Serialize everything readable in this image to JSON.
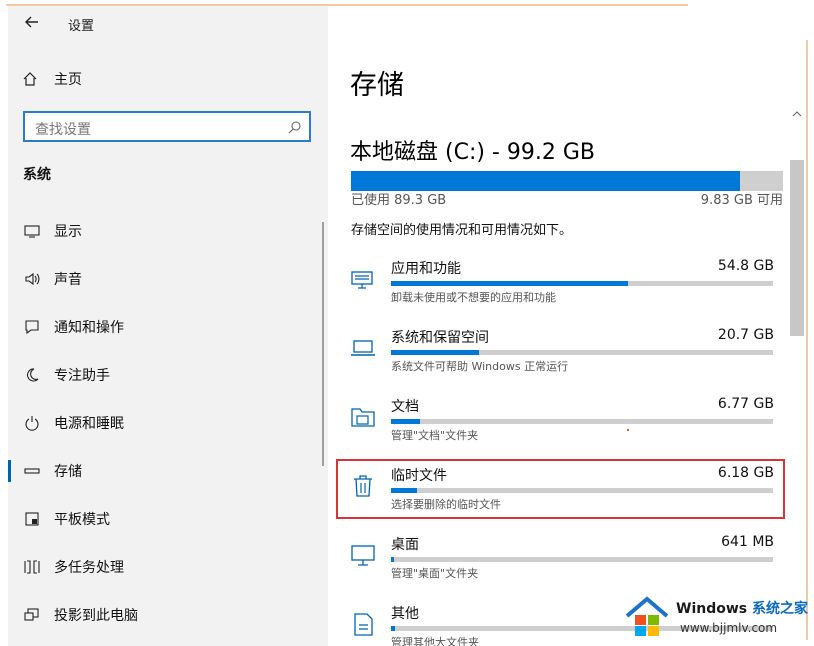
{
  "app": {
    "title": "设置"
  },
  "sidebar": {
    "home_label": "主页",
    "search_placeholder": "查找设置",
    "section": "系统",
    "items": [
      {
        "label": "显示",
        "icon": "monitor-icon"
      },
      {
        "label": "声音",
        "icon": "speaker-icon"
      },
      {
        "label": "通知和操作",
        "icon": "notification-icon"
      },
      {
        "label": "专注助手",
        "icon": "moon-icon"
      },
      {
        "label": "电源和睡眠",
        "icon": "power-icon"
      },
      {
        "label": "存储",
        "icon": "storage-icon",
        "active": true
      },
      {
        "label": "平板模式",
        "icon": "tablet-icon"
      },
      {
        "label": "多任务处理",
        "icon": "multitask-icon"
      },
      {
        "label": "投影到此电脑",
        "icon": "project-icon"
      }
    ]
  },
  "main": {
    "title": "存储",
    "disk": {
      "title": "本地磁盘 (C:) - 99.2 GB",
      "used_label": "已使用 89.3 GB",
      "free_label": "9.83 GB 可用",
      "used_fraction": 0.9
    },
    "description": "存储空间的使用情况和可用情况如下。",
    "categories": [
      {
        "name": "应用和功能",
        "size": "54.8 GB",
        "sub": "卸载未使用或不想要的应用和功能",
        "fraction": 0.62,
        "icon": "apps-icon"
      },
      {
        "name": "系统和保留空间",
        "size": "20.7 GB",
        "sub": "系统文件可帮助 Windows 正常运行",
        "fraction": 0.23,
        "icon": "laptop-icon"
      },
      {
        "name": "文档",
        "size": "6.77 GB",
        "sub": "管理\"文档\"文件夹",
        "fraction": 0.075,
        "icon": "documents-folder-icon"
      },
      {
        "name": "临时文件",
        "size": "6.18 GB",
        "sub": "选择要删除的临时文件",
        "fraction": 0.068,
        "icon": "trash-icon"
      },
      {
        "name": "桌面",
        "size": "641 MB",
        "sub": "管理\"桌面\"文件夹",
        "fraction": 0.008,
        "icon": "desktop-icon"
      },
      {
        "name": "其他",
        "size": "",
        "sub": "管理其他大文件夹",
        "fraction": 0.01,
        "icon": "other-icon"
      }
    ]
  },
  "watermark": {
    "brand": "Windows",
    "brand_zh": "系统之家",
    "url": "www.bjjmlv.com"
  },
  "colors": {
    "accent": "#0078d7",
    "highlight": "#d9343a",
    "sidebar_bg": "#f2f2f2"
  }
}
